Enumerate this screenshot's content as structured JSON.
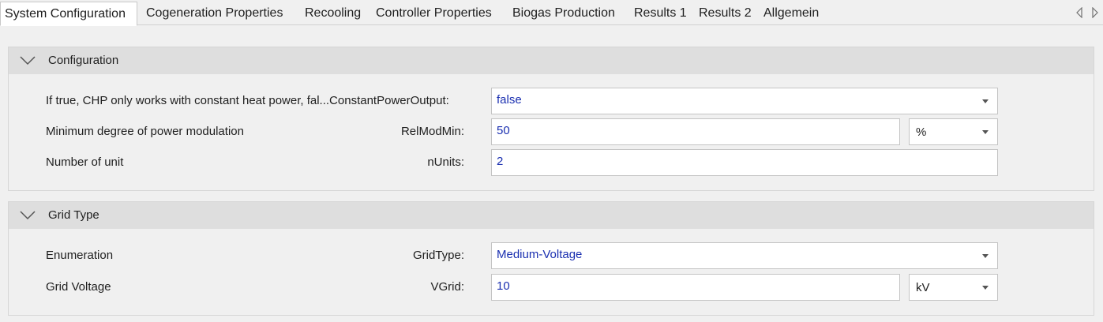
{
  "tabs": {
    "items": [
      {
        "label": "System Configuration",
        "active": true
      },
      {
        "label": "Cogeneration Properties"
      },
      {
        "label": "Recooling"
      },
      {
        "label": "Controller Properties"
      },
      {
        "label": "Biogas Production"
      },
      {
        "label": "Results 1"
      },
      {
        "label": "Results 2"
      },
      {
        "label": "Allgemein"
      }
    ],
    "scroll_left_icon": "triangle-left-icon",
    "scroll_right_icon": "triangle-right-icon"
  },
  "sections": [
    {
      "title": "Configuration",
      "expanded": true,
      "rows": [
        {
          "description": "If true, CHP only works with constant heat power, fal...ConstantPowerOutput:",
          "param": "",
          "value": "false",
          "control": "dropdown"
        },
        {
          "description": "Minimum degree of power modulation",
          "param": "RelModMin:",
          "value": "50",
          "unit": "%",
          "control": "text-with-unit"
        },
        {
          "description": "Number of unit",
          "param": "nUnits:",
          "value": "2",
          "control": "text"
        }
      ]
    },
    {
      "title": "Grid Type",
      "expanded": true,
      "rows": [
        {
          "description": "Enumeration",
          "param": "GridType:",
          "value": "Medium-Voltage",
          "control": "dropdown"
        },
        {
          "description": "Grid Voltage",
          "param": "VGrid:",
          "value": "10",
          "unit": "kV",
          "control": "text-with-unit"
        }
      ]
    }
  ],
  "colors": {
    "value_text": "#1a2fb0",
    "header_bg": "#dedede",
    "background": "#f0f0f0"
  }
}
